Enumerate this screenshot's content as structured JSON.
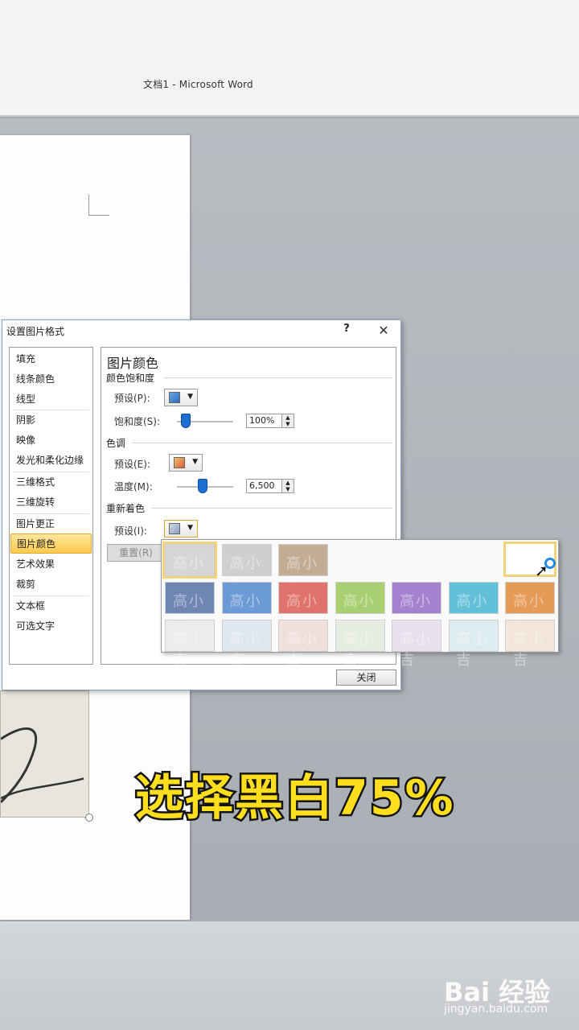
{
  "window": {
    "title": "文档1  -  Microsoft Word"
  },
  "dialog": {
    "title": "设置图片格式",
    "help_label": "?",
    "close_glyph": "✕",
    "sidebar": [
      "填充",
      "线条颜色",
      "线型",
      "阴影",
      "映像",
      "发光和柔化边缘",
      "三维格式",
      "三维旋转",
      "图片更正",
      "图片颜色",
      "艺术效果",
      "裁剪",
      "文本框",
      "可选文字"
    ],
    "active_item": "图片颜色",
    "panel": {
      "title": "图片颜色",
      "saturation": {
        "section": "颜色饱和度",
        "preset_label": "预设(P):",
        "amount_label": "饱和度(S):",
        "value": "100%",
        "level": 0.15
      },
      "tone": {
        "section": "色调",
        "preset_label": "预设(E):",
        "amount_label": "温度(M):",
        "value": "6,500",
        "level": 0.45
      },
      "recolor": {
        "section": "重新着色",
        "preset_label": "预设(I):",
        "reset_label": "重置(R)"
      }
    },
    "close_button": "关闭"
  },
  "gallery": {
    "tile_text": "高小吉",
    "rows": [
      [
        "#d6d6d6",
        "#cfcfcf",
        "#c2ad94"
      ],
      [
        "#6f86b3",
        "#6b9ad6",
        "#e0736b",
        "#a8d072",
        "#a582cf",
        "#63c0d9",
        "#e69a58"
      ],
      [
        "#ececec",
        "#dfe6ef",
        "#f0dfdc",
        "#e6ecdf",
        "#e8e0ec",
        "#dfecef",
        "#f1e6d8"
      ]
    ]
  },
  "caption": "选择黑白75%",
  "watermark": {
    "logo": "Bai 经验",
    "url": "jingyan.baidu.com"
  }
}
